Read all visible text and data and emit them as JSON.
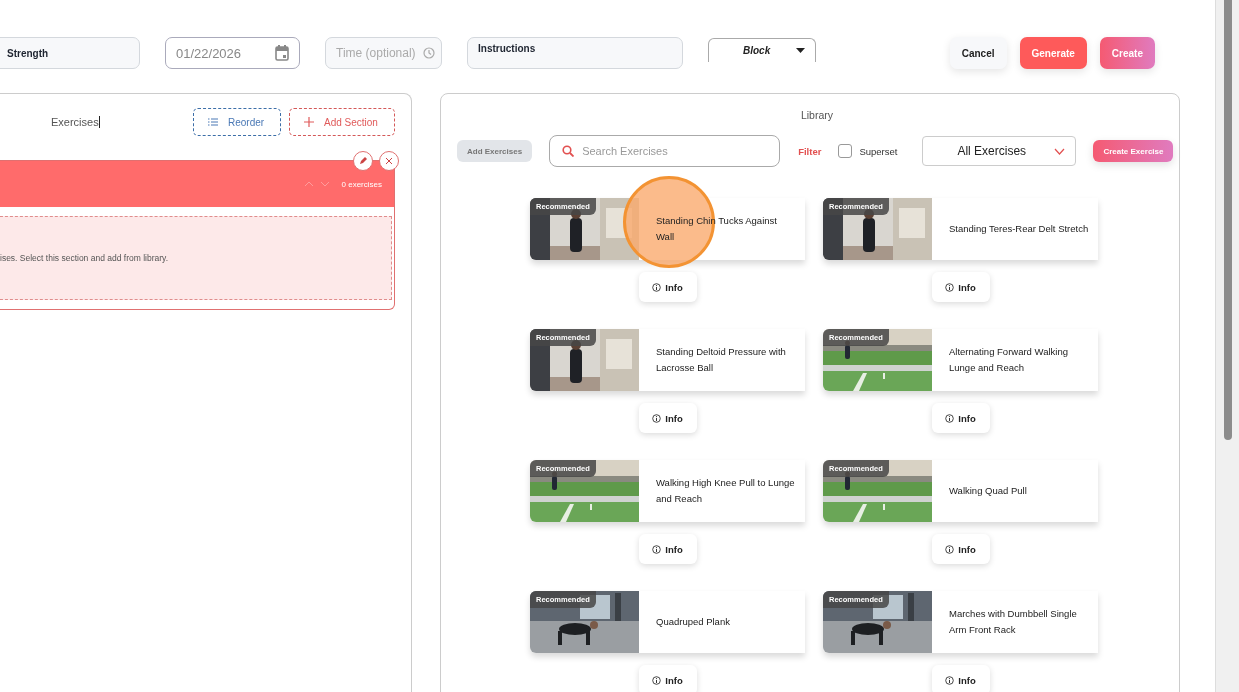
{
  "header": {
    "name_field": {
      "value": "Strength"
    },
    "date_field": {
      "value": "01/22/2026"
    },
    "time_field": {
      "placeholder": "Time (optional)"
    },
    "instructions_field": {
      "value": "Instructions"
    },
    "type_select": {
      "value": "Block"
    },
    "buttons": [
      {
        "label": "Cancel",
        "kind": "plain"
      },
      {
        "label": "Generate",
        "kind": "primary"
      },
      {
        "label": "Create",
        "kind": "gradient"
      }
    ]
  },
  "workout": {
    "title": "Exercises",
    "actions": [
      {
        "label": "Reorder",
        "kind": "reorder"
      },
      {
        "label": "Add Section",
        "kind": "add"
      }
    ],
    "section": {
      "count": "0 exercises",
      "empty_text": "ises. Select this section and add from library."
    }
  },
  "library": {
    "title": "Library",
    "add_button": "Add Exercises",
    "search": {
      "placeholder": "Search Exercises"
    },
    "filter_label": "Filter",
    "superset": {
      "label": "Superset",
      "checked": false
    },
    "category_select": {
      "value": "All Exercises"
    },
    "create_button": "Create Exercise",
    "exercises": [
      {
        "title": "Standing Chin Tucks Against Wall",
        "badge": "Recommended",
        "info": "Info",
        "kind": "picture"
      },
      {
        "title": "Standing Teres-Rear Delt Stretch",
        "badge": "Recommended",
        "info": "Info",
        "kind": "picture"
      },
      {
        "title": "Standing Deltoid Pressure with Lacrosse Ball",
        "badge": "Recommended",
        "info": "Info",
        "kind": "picture"
      },
      {
        "title": "Alternating Forward Walking Lunge and Reach",
        "badge": "Recommended",
        "info": "Info",
        "kind": "picture"
      },
      {
        "title": "Walking High Knee Pull to Lunge and Reach",
        "badge": "Recommended",
        "info": "Info",
        "kind": "picture"
      },
      {
        "title": "Walking Quad Pull",
        "badge": "Recommended",
        "info": "Info",
        "kind": "picture"
      },
      {
        "title": "Quadruped Plank",
        "badge": "Recommended",
        "info": "Info",
        "kind": "picture"
      },
      {
        "title": "Marches with Dumbbell Single Arm Front Rack",
        "badge": "Recommended",
        "info": "Info",
        "kind": "picture"
      }
    ]
  }
}
